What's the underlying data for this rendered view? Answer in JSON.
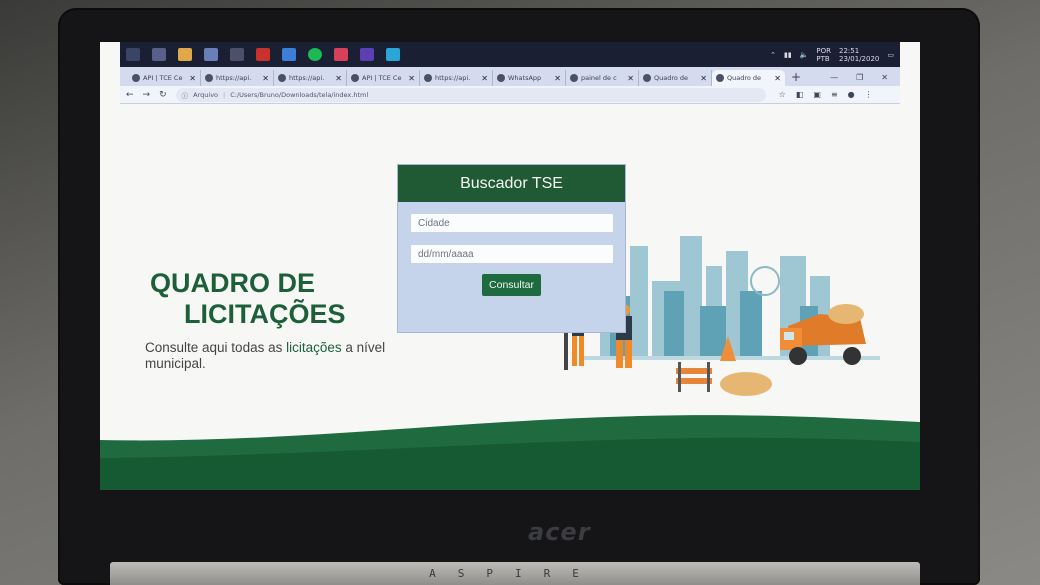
{
  "taskbar": {
    "icons": [
      "start-icon",
      "task-view-icon",
      "file-explorer-icon",
      "app-icon",
      "terminal-icon",
      "pdf-icon",
      "code-icon",
      "spotify-icon",
      "shield-icon",
      "visual-studio-icon",
      "store-icon"
    ],
    "tray": {
      "language": "POR",
      "layout": "PTB",
      "time": "22:51",
      "date": "23/01/2020"
    }
  },
  "browser": {
    "tabs": [
      {
        "title": "API | TCE Ce",
        "active": false
      },
      {
        "title": "https://api.",
        "active": false
      },
      {
        "title": "https://api.",
        "active": false
      },
      {
        "title": "API | TCE Ce",
        "active": false
      },
      {
        "title": "https://api.",
        "active": false
      },
      {
        "title": "WhatsApp",
        "active": false
      },
      {
        "title": "painel de c",
        "active": false
      },
      {
        "title": "Quadro de",
        "active": false
      },
      {
        "title": "Quadro de",
        "active": true
      }
    ],
    "address": {
      "label": "Arquivo",
      "url": "C:/Users/Bruno/Downloads/tela/index.html"
    }
  },
  "page": {
    "hero_title_line1": "QUADRO DE",
    "hero_title_line2": "LICITAÇÕES",
    "hero_sub_part1": "Consulte aqui todas as",
    "hero_sub_highlight": "licitações",
    "hero_sub_part2": "a nível municipal.",
    "card_title": "Buscador TSE",
    "city_placeholder": "Cidade",
    "date_placeholder": "dd/mm/aaaa",
    "submit_label": "Consultar"
  },
  "device": {
    "brand": "acer",
    "model": "ASPIRE"
  },
  "colors": {
    "brand_green": "#1f5a35",
    "card_bg": "#c5d3eb",
    "page_bg": "#f7f8f5"
  }
}
